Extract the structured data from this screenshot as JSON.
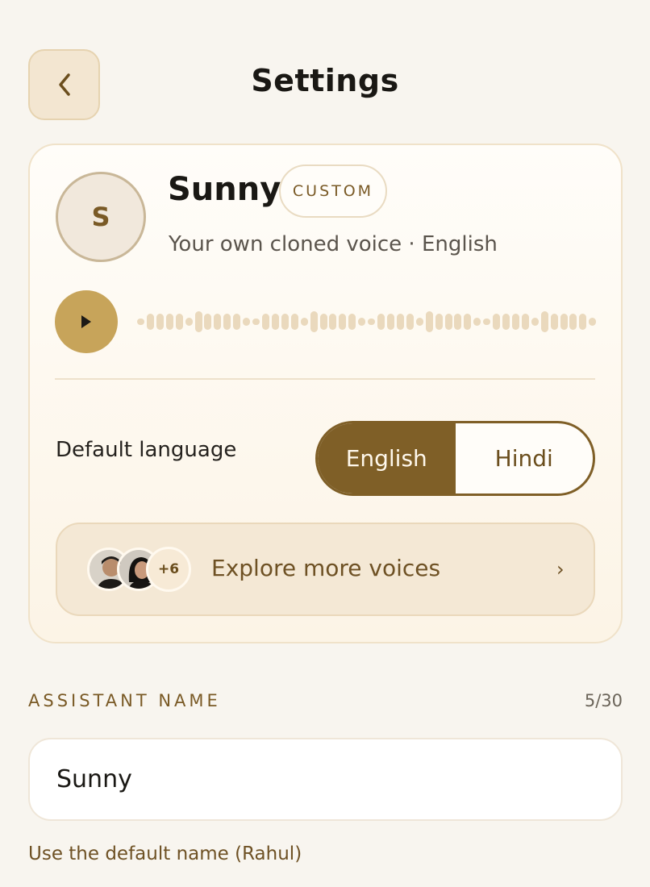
{
  "header": {
    "title": "Settings"
  },
  "voice": {
    "avatar_initial": "S",
    "name": "Sunny",
    "badge": "CUSTOM",
    "subtitle": "Your own cloned voice · English"
  },
  "language": {
    "label": "Default language",
    "options": [
      "English",
      "Hindi"
    ],
    "selected": "English"
  },
  "explore": {
    "extra_count": "+6",
    "label": "Explore more voices",
    "chevron": "›"
  },
  "assistant_name": {
    "section_label": "ASSISTANT NAME",
    "counter": "5/30",
    "value": "Sunny",
    "default_link": "Use the default name (Rahul)"
  },
  "colors": {
    "accent": "#7f5f27",
    "play": "#c7a45a",
    "background": "#f8f5ef"
  }
}
